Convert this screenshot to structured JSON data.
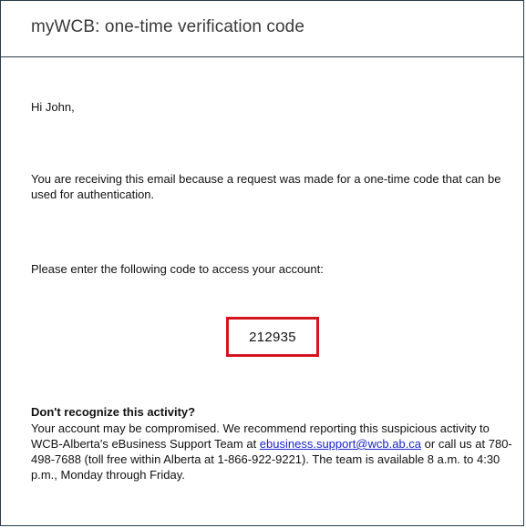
{
  "email": {
    "subject": "myWCB: one-time verification code",
    "greeting": "Hi John,",
    "reason": "You are receiving this email because a request was made for a one-time code that can be used for authentication.",
    "instruction": "Please enter the following code to access your account:",
    "code": "212935",
    "warning": {
      "heading": "Don't recognize this activity?",
      "text_before_link": "Your account may be compromised. We recommend reporting this suspicious activity to WCB-Alberta's eBusiness Support Team at ",
      "link_text": "ebusiness.support@wcb.ab.ca",
      "text_after_link": " or call us at 780-498-7688 (toll free within Alberta at 1-866-922-9221). The team is available 8 a.m. to 4:30 p.m., Monday through Friday."
    }
  },
  "colors": {
    "code_highlight_border": "#d4141c",
    "link": "#1a25cc",
    "frame_border": "#2b3a4a"
  }
}
